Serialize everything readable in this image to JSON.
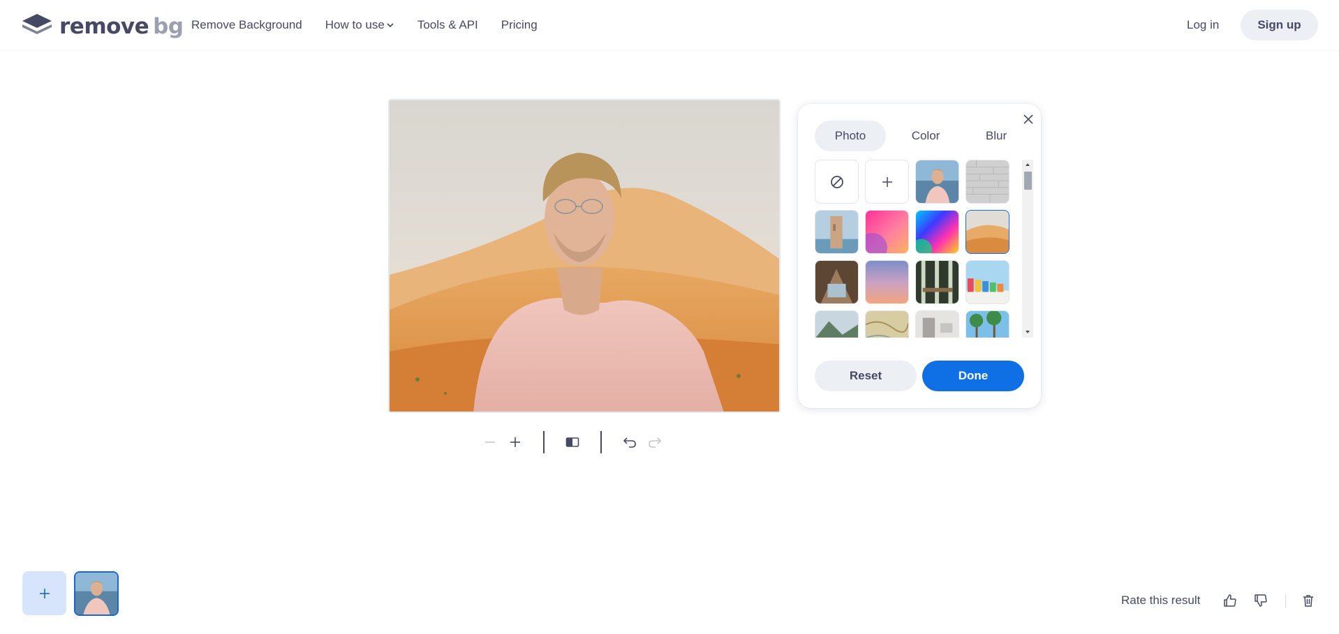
{
  "header": {
    "logo_word1": "remove",
    "logo_word2": "bg",
    "nav": [
      {
        "label": "Remove Background"
      },
      {
        "label": "How to use"
      },
      {
        "label": "Tools & API"
      },
      {
        "label": "Pricing"
      }
    ],
    "login_label": "Log in",
    "signup_label": "Sign up"
  },
  "panel": {
    "tabs": [
      {
        "label": "Photo",
        "active": true
      },
      {
        "label": "Color",
        "active": false
      },
      {
        "label": "Blur",
        "active": false
      }
    ],
    "reset_label": "Reset",
    "done_label": "Done",
    "selected_index": 7
  },
  "bottom": {
    "rate_label": "Rate this result"
  },
  "colors": {
    "primary": "#0f70e6",
    "text": "#454964",
    "button_bg": "#eceff3",
    "add_tile_bg": "#d6e5fb"
  }
}
